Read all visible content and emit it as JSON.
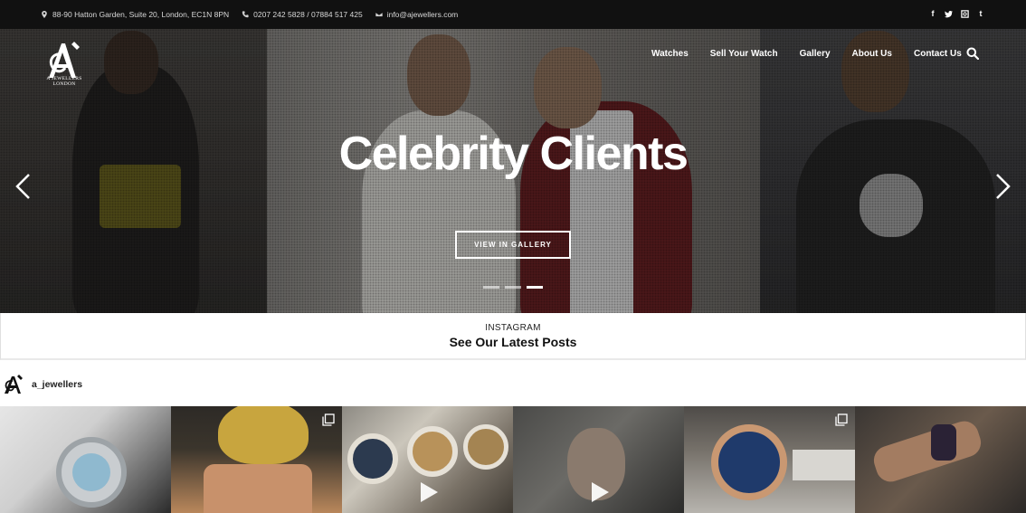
{
  "topbar": {
    "address": "88-90 Hatton Garden, Suite 20, London, EC1N 8PN",
    "phone": "0207 242 5828 / 07884 517 425",
    "email": "info@ajewellers.com",
    "social_icons": [
      "facebook-icon",
      "twitter-icon",
      "instagram-icon",
      "tumblr-icon"
    ]
  },
  "brand": {
    "logo_line1": "A JEWELLERS",
    "logo_line2": "LONDON"
  },
  "nav": {
    "items": [
      "Watches",
      "Sell Your Watch",
      "Gallery",
      "About Us",
      "Contact Us"
    ]
  },
  "hero": {
    "title": "Celebrity Clients",
    "button_label": "VIEW IN GALLERY",
    "slides_total": 3,
    "active_slide": 3
  },
  "instagram": {
    "kicker": "INSTAGRAM",
    "title": "See Our Latest Posts",
    "username": "a_jewellers"
  },
  "colors": {
    "topbar_bg": "#111111",
    "text_dark": "#111111"
  }
}
